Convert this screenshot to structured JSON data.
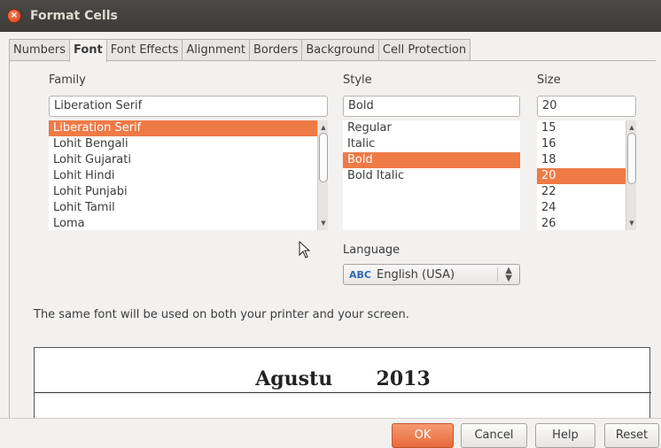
{
  "window": {
    "title": "Format Cells",
    "close_glyph": "×"
  },
  "tabs": [
    "Numbers",
    "Font",
    "Font Effects",
    "Alignment",
    "Borders",
    "Background",
    "Cell Protection"
  ],
  "active_tab": "Font",
  "family": {
    "label": "Family",
    "value": "Liberation Serif",
    "items": [
      "Liberation Serif",
      "Lohit Bengali",
      "Lohit Gujarati",
      "Lohit Hindi",
      "Lohit Punjabi",
      "Lohit Tamil",
      "Loma"
    ],
    "selected": "Liberation Serif"
  },
  "style": {
    "label": "Style",
    "value": "Bold",
    "items": [
      "Regular",
      "Italic",
      "Bold",
      "Bold Italic"
    ],
    "selected": "Bold"
  },
  "size": {
    "label": "Size",
    "value": "20",
    "items": [
      "15",
      "16",
      "18",
      "20",
      "22",
      "24",
      "26"
    ],
    "selected": "20"
  },
  "language": {
    "label": "Language",
    "value": "English (USA)",
    "icon": "spellcheck-icon",
    "icon_glyph": "ABC"
  },
  "info_text": "The same font will be used on both your printer and your screen.",
  "preview": {
    "text1": "Agustu",
    "text2": "2013"
  },
  "buttons": {
    "ok": "OK",
    "cancel": "Cancel",
    "help": "Help",
    "reset": "Reset"
  },
  "colors": {
    "accent": "#ee7a46",
    "titlebar": "#3c3b37"
  }
}
